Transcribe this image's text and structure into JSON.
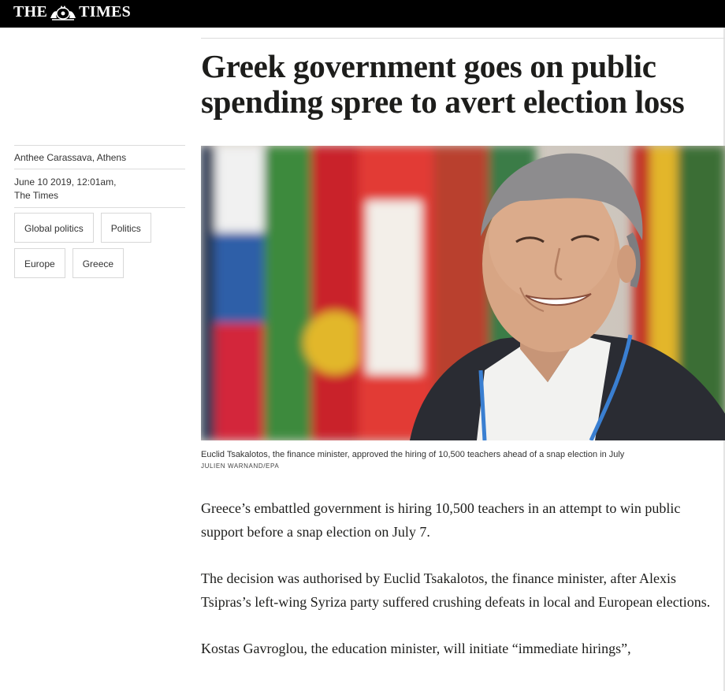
{
  "masthead": {
    "logo_left": "THE",
    "logo_right": "TIMES",
    "crest_icon": "royal-crest-icon"
  },
  "article": {
    "headline": "Greek government goes on public spending spree to avert election loss",
    "byline": "Anthee Carassava, Athens",
    "date": "June 10 2019, 12:01am,",
    "publication": "The Times",
    "tags": [
      "Global politics",
      "Politics",
      "Europe",
      "Greece"
    ],
    "image_caption": "Euclid Tsakalotos, the finance minister, approved the hiring of 10,500 teachers ahead of a snap election in July",
    "image_credit": "JULIEN WARNAND/EPA",
    "paragraphs": [
      "Greece’s embattled government is hiring 10,500 teachers in an attempt to win public support before a snap election on July 7.",
      "The decision was authorised by Euclid Tsakalotos, the finance minister, after Alexis Tsipras’s left-wing Syriza party suffered crushing defeats in local and European elections.",
      "Kostas Gavroglou, the education minister, will initiate “immediate hirings”,"
    ]
  },
  "colors": {
    "masthead_bg": "#000000",
    "text": "#1d1d1b",
    "rule": "#dcdcdc"
  }
}
